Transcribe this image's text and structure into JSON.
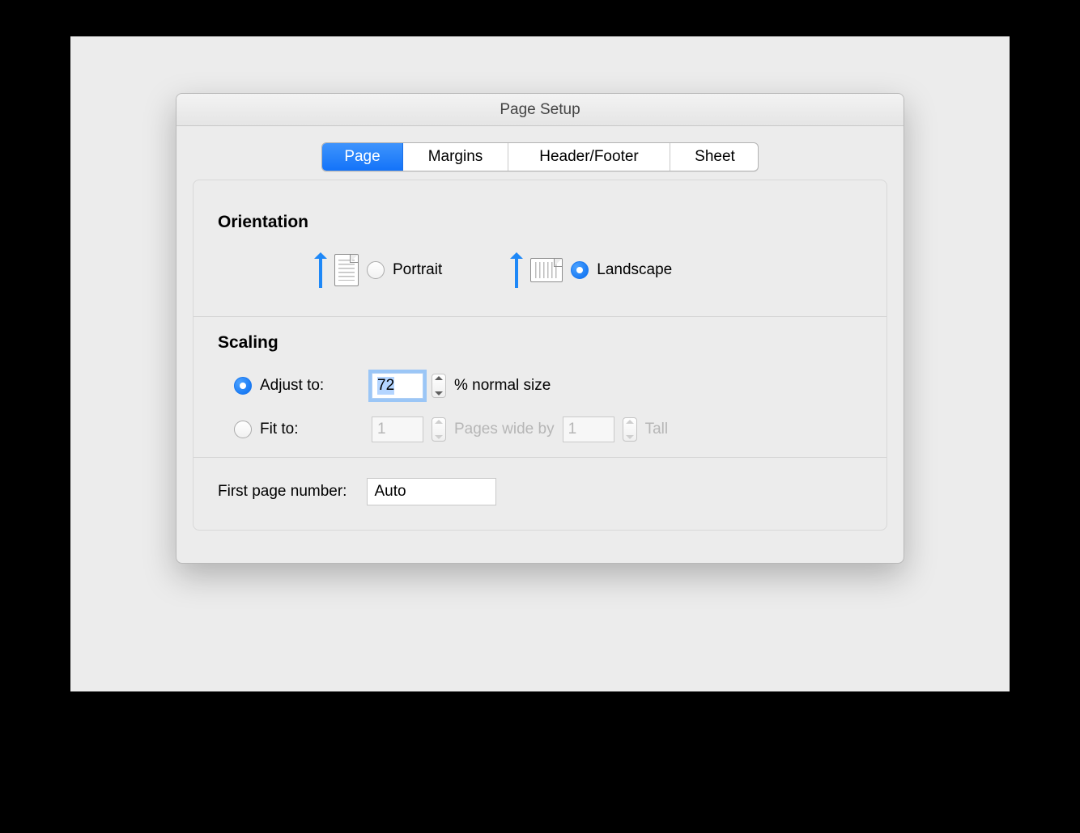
{
  "dialog": {
    "title": "Page Setup",
    "tabs": [
      "Page",
      "Margins",
      "Header/Footer",
      "Sheet"
    ],
    "active_tab": "Page"
  },
  "orientation": {
    "heading": "Orientation",
    "portrait_label": "Portrait",
    "landscape_label": "Landscape",
    "selected": "landscape"
  },
  "scaling": {
    "heading": "Scaling",
    "adjust_to_label": "Adjust to:",
    "adjust_to_value": "72",
    "adjust_to_suffix": "% normal size",
    "fit_to_label": "Fit to:",
    "fit_pages_wide": "1",
    "fit_between_label": "Pages wide by",
    "fit_pages_tall": "1",
    "fit_tall_label": "Tall",
    "selected": "adjust"
  },
  "first_page": {
    "label": "First page number:",
    "value": "Auto"
  }
}
